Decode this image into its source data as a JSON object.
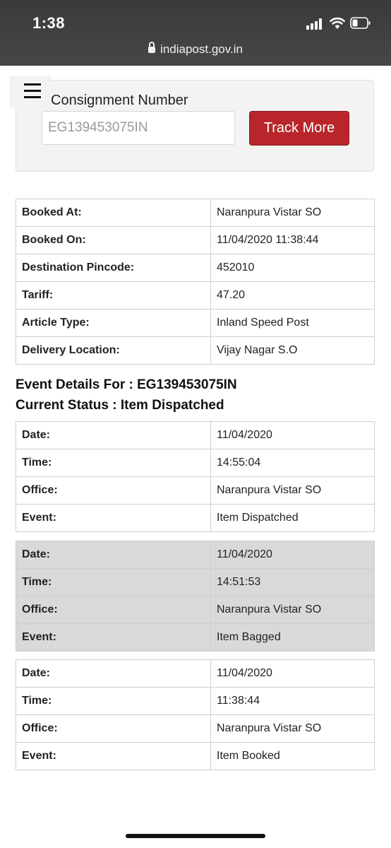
{
  "status_bar": {
    "time": "1:38",
    "url": "indiapost.gov.in"
  },
  "search": {
    "label": "Consignment Number",
    "input_value": "EG139453075IN",
    "button_label": "Track More"
  },
  "booking": [
    {
      "label": "Booked At:",
      "value": "Naranpura Vistar SO"
    },
    {
      "label": "Booked On:",
      "value": "11/04/2020 11:38:44"
    },
    {
      "label": "Destination Pincode:",
      "value": "452010"
    },
    {
      "label": "Tariff:",
      "value": "47.20"
    },
    {
      "label": "Article Type:",
      "value": "Inland Speed Post"
    },
    {
      "label": "Delivery Location:",
      "value": "Vijay Nagar S.O"
    }
  ],
  "event_heading": "Event Details For : EG139453075IN",
  "status_heading": "Current Status : Item Dispatched",
  "events": [
    {
      "date_label": "Date:",
      "date": "11/04/2020",
      "time_label": "Time:",
      "time": "14:55:04",
      "office_label": "Office:",
      "office": "Naranpura Vistar SO",
      "event_label": "Event:",
      "event": "Item Dispatched"
    },
    {
      "date_label": "Date:",
      "date": "11/04/2020",
      "time_label": "Time:",
      "time": "14:51:53",
      "office_label": "Office:",
      "office": "Naranpura Vistar SO",
      "event_label": "Event:",
      "event": "Item Bagged"
    },
    {
      "date_label": "Date:",
      "date": "11/04/2020",
      "time_label": "Time:",
      "time": "11:38:44",
      "office_label": "Office:",
      "office": "Naranpura Vistar SO",
      "event_label": "Event:",
      "event": "Item Booked"
    }
  ],
  "colors": {
    "accent": "#b8262b",
    "shaded_row": "#d9d9d9",
    "status_bar": "#404040"
  }
}
